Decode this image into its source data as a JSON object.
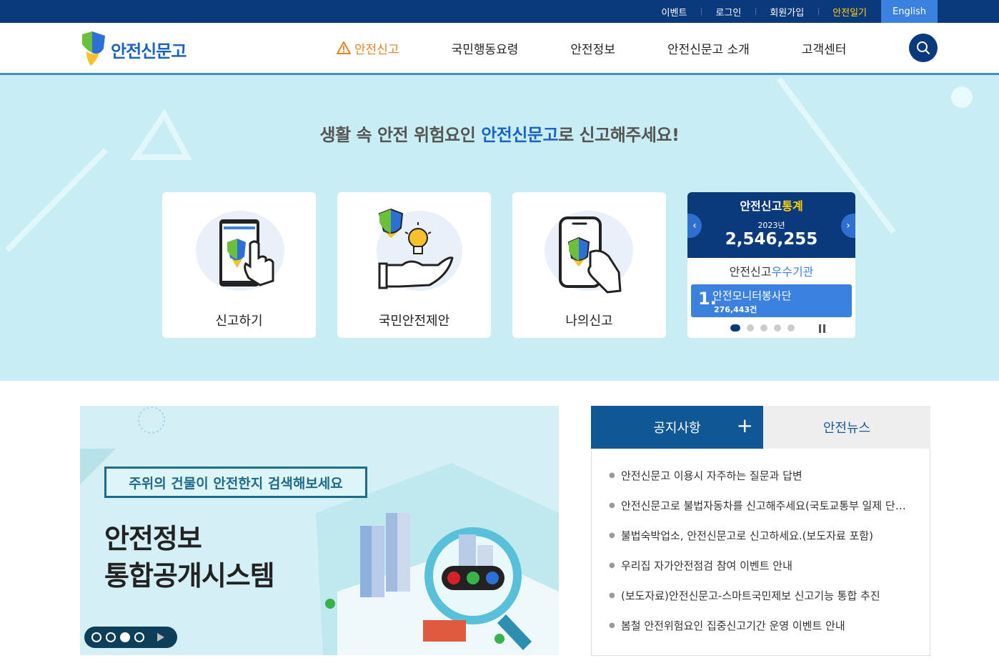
{
  "util": {
    "links": [
      "이벤트",
      "로그인",
      "회원가입",
      "안전일기"
    ],
    "english": "English"
  },
  "header": {
    "logo_text": "안전신문고",
    "nav": [
      "안전신고",
      "국민행동요령",
      "안전정보",
      "안전신문고 소개",
      "고객센터"
    ],
    "active_nav_icon": "warning-triangle-icon",
    "search_icon": "search-icon"
  },
  "hero": {
    "title_pre": "생활 속 안전 위험요인 ",
    "title_accent": "안전신문고",
    "title_post": "로 신고해주세요!",
    "cards": [
      {
        "label": "신고하기",
        "icon": "phone-tap-shield-icon"
      },
      {
        "label": "국민안전제안",
        "icon": "hand-lightbulb-shield-icon"
      },
      {
        "label": "나의신고",
        "icon": "phone-hand-shield-icon"
      }
    ],
    "stats": {
      "title_main": "안전신고",
      "title_accent": "통계",
      "year": "2023년",
      "count": "2,546,255",
      "sub_main": "안전신고",
      "sub_accent": "우수기관",
      "rank_num": "1.",
      "rank_name": "안전모니터봉사단",
      "rank_value": "276,443건",
      "prev": "‹",
      "next": "›",
      "active_page": 1,
      "total_pages": 5
    }
  },
  "banner": {
    "tag": "주위의 건물이 안전한지 검색해보세요",
    "headline_1": "안전정보",
    "headline_2": "통합공개시스템",
    "active_slide": 3,
    "total_slides": 4
  },
  "notice": {
    "tab_active": "공지사항",
    "tab_inactive": "안전뉴스",
    "plus": "+",
    "items": [
      "안전신문고 이용시 자주하는 질문과 답변",
      "안전신문고로 불법자동차를 신고해주세요(국토교통부 일제 단속 기간)",
      "불법숙박업소, 안전신문고로 신고하세요.(보도자료 포함)",
      "우리집 자가안전점검 참여 이벤트 안내",
      "(보도자료)안전신문고-스마트국민제보 신고기능 통합 추진",
      "봄철 안전위험요인 집중신고기간 운영 이벤트 안내"
    ]
  },
  "colors": {
    "navy": "#0b3a7c",
    "blue": "#3b82e0",
    "hero_bg": "#c8eef4",
    "accent_orange": "#e8821e",
    "accent_yellow": "#ffd200",
    "tab_blue": "#0f5894"
  }
}
